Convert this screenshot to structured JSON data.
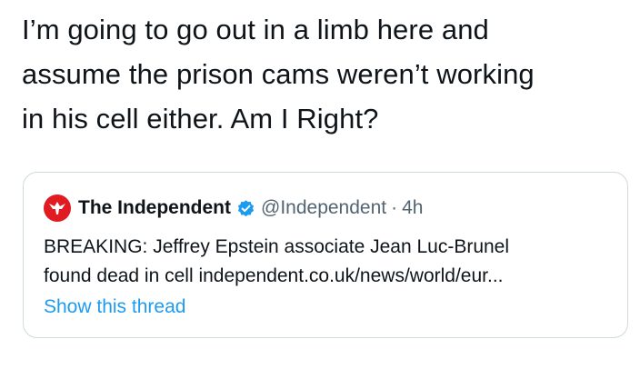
{
  "tweet": {
    "text_lines": [
      "I’m going to go out in a limb here and",
      "assume the prison cams weren’t working",
      "in his cell either. Am I Right?"
    ]
  },
  "quoted_tweet": {
    "author_name": "The Independent",
    "handle": "@Independent",
    "separator": "·",
    "time": "4h",
    "verified": true,
    "avatar_icon": "eagle-logo-icon",
    "avatar_color": "#e01b22",
    "body_lines": [
      "BREAKING: Jeffrey Epstein associate Jean Luc-Brunel",
      "found dead in cell independent.co.uk/news/world/eur..."
    ],
    "show_thread_label": "Show this thread"
  },
  "colors": {
    "text": "#0f1419",
    "secondary": "#536471",
    "link": "#1d9bf0",
    "border": "#cfd9de"
  }
}
